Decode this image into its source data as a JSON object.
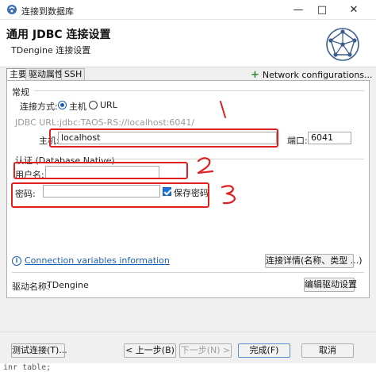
{
  "window": {
    "title": "连接到数据库",
    "icons": {
      "app": "database-plug-icon",
      "minimize": "minimize-icon",
      "maximize": "maximize-icon",
      "close": "close-icon"
    }
  },
  "header": {
    "title": "通用 JDBC 连接设置",
    "subtitle": "TDengine 连接设置",
    "icon": "network-pentagon-icon"
  },
  "tabs": [
    {
      "label": "主要",
      "active": true
    },
    {
      "label": "驱动属性",
      "active": false
    },
    {
      "label": "SSH",
      "active": false
    }
  ],
  "network_config": {
    "label": "Network configurations..."
  },
  "general": {
    "group_label": "常规",
    "connect_method_label": "连接方式:",
    "options": [
      {
        "label": "主机",
        "selected": true
      },
      {
        "label": "URL",
        "selected": false
      }
    ],
    "jdbc_url_label": "JDBC URL:",
    "jdbc_url_value": "jdbc:TAOS-RS://localhost:6041/",
    "host_label": "主机:",
    "host_value": "localhost",
    "port_label": "端口:",
    "port_value": "6041"
  },
  "auth": {
    "group_label": "认证 (Database Native)",
    "username_label": "用户名:",
    "username_value": "",
    "password_label": "密码:",
    "password_value": "",
    "save_password_label": "保存密码",
    "save_password_checked": true
  },
  "connection_vars": {
    "link_label": "Connection variables information",
    "icon": "info-icon"
  },
  "details_button": "连接详情(名称、类型 ...)",
  "driver": {
    "name_label": "驱动名称:",
    "name_value": "TDengine",
    "edit_button": "编辑驱动设置"
  },
  "footer": {
    "test_button": "测试连接(T)...",
    "back_button": "< 上一步(B)",
    "next_button": "下一步(N) >",
    "finish_button": "完成(F)",
    "cancel_button": "取消"
  },
  "annotations": {
    "mark_1": "1",
    "mark_2": "2",
    "mark_3": "3",
    "color": "#e02020"
  },
  "background_code": "inr table;"
}
